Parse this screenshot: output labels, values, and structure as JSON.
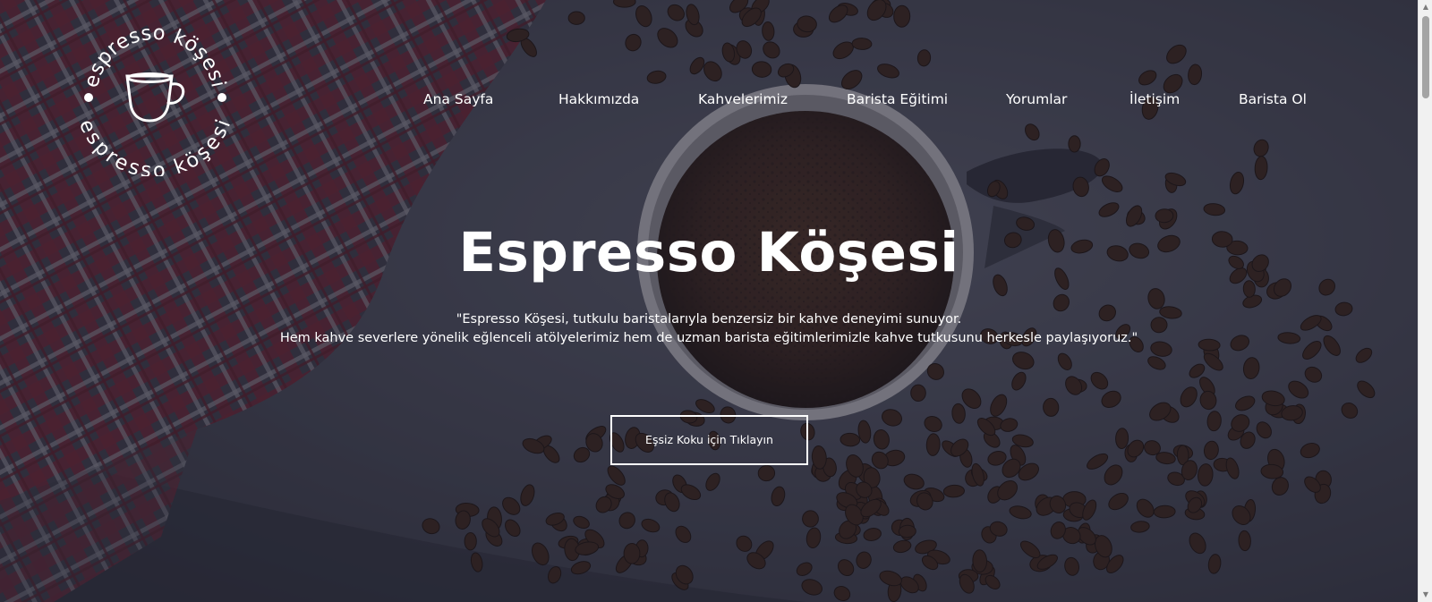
{
  "logo": {
    "text_top": "espresso köşesi",
    "text_bottom": "espresso köşesi",
    "icon": "coffee-cup-icon"
  },
  "nav": {
    "items": [
      {
        "label": "Ana Sayfa"
      },
      {
        "label": "Hakkımızda"
      },
      {
        "label": "Kahvelerimiz"
      },
      {
        "label": "Barista Eğitimi"
      },
      {
        "label": "Yorumlar"
      },
      {
        "label": "İletişim"
      },
      {
        "label": "Barista Ol"
      }
    ]
  },
  "hero": {
    "title": "Espresso Köşesi",
    "description_line1": "\"Espresso Köşesi, tutkulu baristalarıyla benzersiz bir kahve deneyimi sunuyor.",
    "description_line2": "Hem kahve severlere yönelik eğlenceli atölyelerimiz hem de uzman barista eğitimlerimizle kahve tutkusunu herkesle paylaşıyoruz.\"",
    "cta_label": "Eşsiz Koku için Tıklayın"
  },
  "colors": {
    "text": "#ffffff",
    "overlay": "#1e2030",
    "cloth": "#4a4c59",
    "towel_red": "#7a2530",
    "coffee": "#3a2418"
  },
  "icons": {
    "scroll_up": "chevron-up-icon",
    "scroll_down": "chevron-down-icon"
  }
}
